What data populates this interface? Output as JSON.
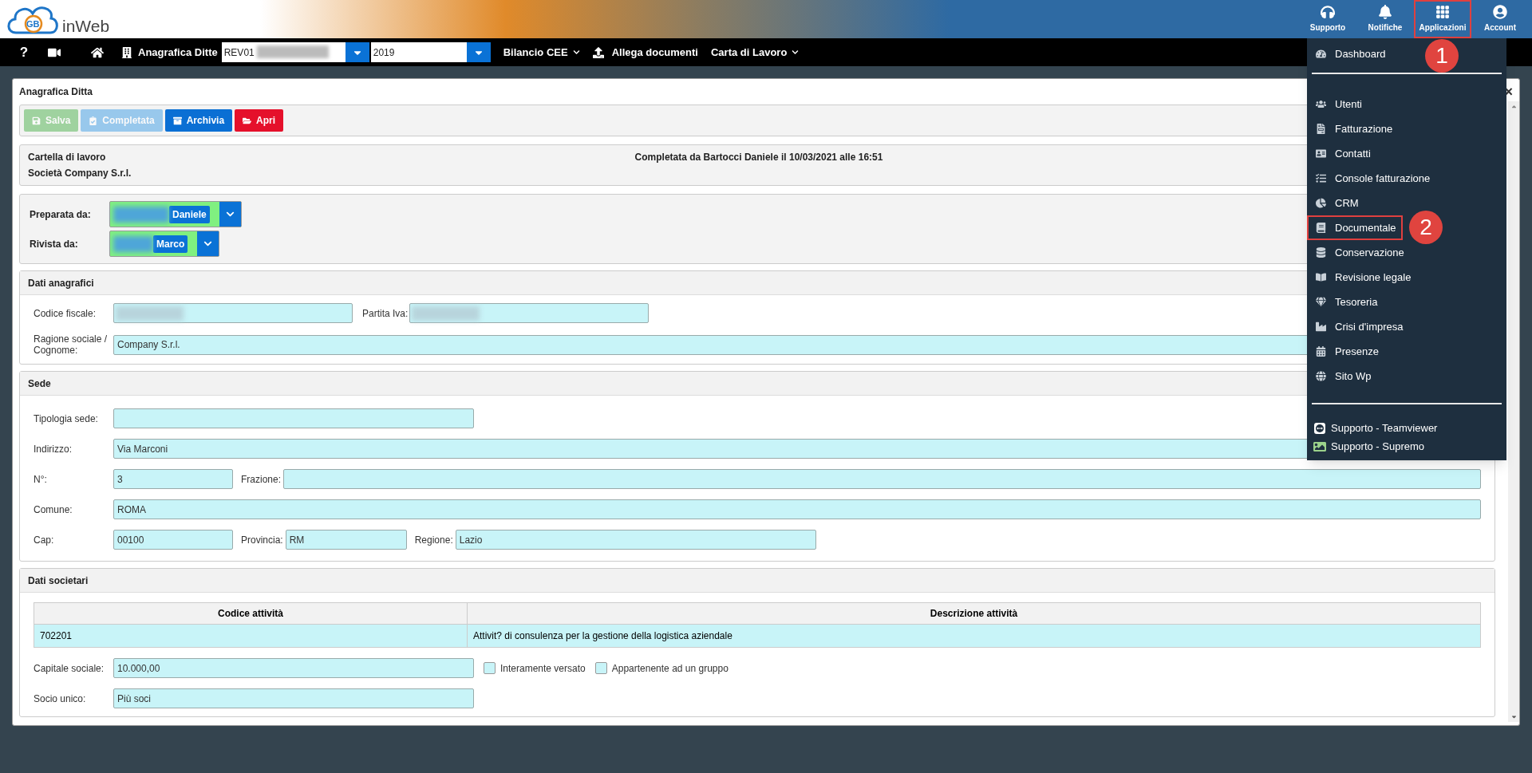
{
  "header": {
    "logo_mark": "GB",
    "logo_text": "inWeb",
    "actions": [
      {
        "label": "Supporto",
        "highlighted": false
      },
      {
        "label": "Notifiche",
        "highlighted": false
      },
      {
        "label": "Applicazioni",
        "highlighted": true,
        "callout": "1"
      },
      {
        "label": "Account",
        "highlighted": false
      }
    ]
  },
  "navbar": {
    "help": "?",
    "title": "Anagrafica Ditte",
    "company_select": {
      "value": "REV01"
    },
    "year_select": {
      "value": "2019"
    },
    "menus": [
      {
        "label": "Bilancio CEE",
        "kind": "dropdown"
      },
      {
        "label": "Allega documenti",
        "kind": "upload"
      },
      {
        "label": "Carta di Lavoro",
        "kind": "dropdown"
      }
    ]
  },
  "panel": {
    "title": "Anagrafica Ditta",
    "close": "×"
  },
  "toolbar": [
    {
      "label": "Salva",
      "kind": "save",
      "disabled": true
    },
    {
      "label": "Completata",
      "kind": "completed",
      "disabled": true
    },
    {
      "label": "Archivia",
      "kind": "archive",
      "disabled": false
    },
    {
      "label": "Apri",
      "kind": "open",
      "disabled": false
    }
  ],
  "work_folder": {
    "title": "Cartella di lavoro",
    "company": "Società Company S.r.l.",
    "status": "Completata da Bartocci Daniele il 10/03/2021 alle 16:51"
  },
  "reviewers": [
    {
      "label": "Preparata da:",
      "value": "Daniele"
    },
    {
      "label": "Rivista da:",
      "value": "Marco"
    }
  ],
  "dati_anagrafici": {
    "title": "Dati anagrafici",
    "codice_fiscale": {
      "label": "Codice fiscale:"
    },
    "partita_iva": {
      "label": "Partita Iva:"
    },
    "ragione_sociale": {
      "label": "Ragione sociale / Cognome:",
      "value": "Company S.r.l."
    }
  },
  "sede": {
    "title": "Sede",
    "tipologia": {
      "label": "Tipologia sede:"
    },
    "indirizzo": {
      "label": "Indirizzo:",
      "value": "Via Marconi"
    },
    "numero": {
      "label": "N°:",
      "value": "3"
    },
    "frazione": {
      "label": "Frazione:"
    },
    "comune": {
      "label": "Comune:",
      "value": "ROMA"
    },
    "cap": {
      "label": "Cap:",
      "value": "00100"
    },
    "provincia": {
      "label": "Provincia:",
      "value": "RM"
    },
    "regione": {
      "label": "Regione:",
      "value": "Lazio"
    }
  },
  "dati_societari": {
    "title": "Dati societari",
    "table": {
      "columns": [
        "Codice attività",
        "Descrizione attività"
      ],
      "rows": [
        [
          "702201",
          "Attivit? di consulenza per la gestione della logistica aziendale"
        ]
      ]
    },
    "capitale": {
      "label": "Capitale sociale:",
      "value": "10.000,00"
    },
    "checkboxes": [
      {
        "label": "Interamente versato",
        "checked": false
      },
      {
        "label": "Appartenente ad un gruppo",
        "checked": false
      }
    ],
    "socio_unico": {
      "label": "Socio unico:",
      "value": "Più soci"
    }
  },
  "apps_menu": {
    "top": [
      {
        "label": "Dashboard",
        "highlighted": false
      }
    ],
    "items": [
      {
        "label": "Utenti",
        "highlighted": false
      },
      {
        "label": "Fatturazione",
        "highlighted": false
      },
      {
        "label": "Contatti",
        "highlighted": false
      },
      {
        "label": "Console fatturazione",
        "highlighted": false
      },
      {
        "label": "CRM",
        "highlighted": false
      },
      {
        "label": "Documentale",
        "highlighted": true,
        "callout": "2"
      },
      {
        "label": "Conservazione",
        "highlighted": false
      },
      {
        "label": "Revisione legale",
        "highlighted": false
      },
      {
        "label": "Tesoreria",
        "highlighted": false
      },
      {
        "label": "Crisi d'impresa",
        "highlighted": false
      },
      {
        "label": "Presenze",
        "highlighted": false
      },
      {
        "label": "Sito Wp",
        "highlighted": false
      }
    ],
    "support": [
      {
        "label": "Supporto - Teamviewer"
      },
      {
        "label": "Supporto - Supremo"
      }
    ]
  }
}
